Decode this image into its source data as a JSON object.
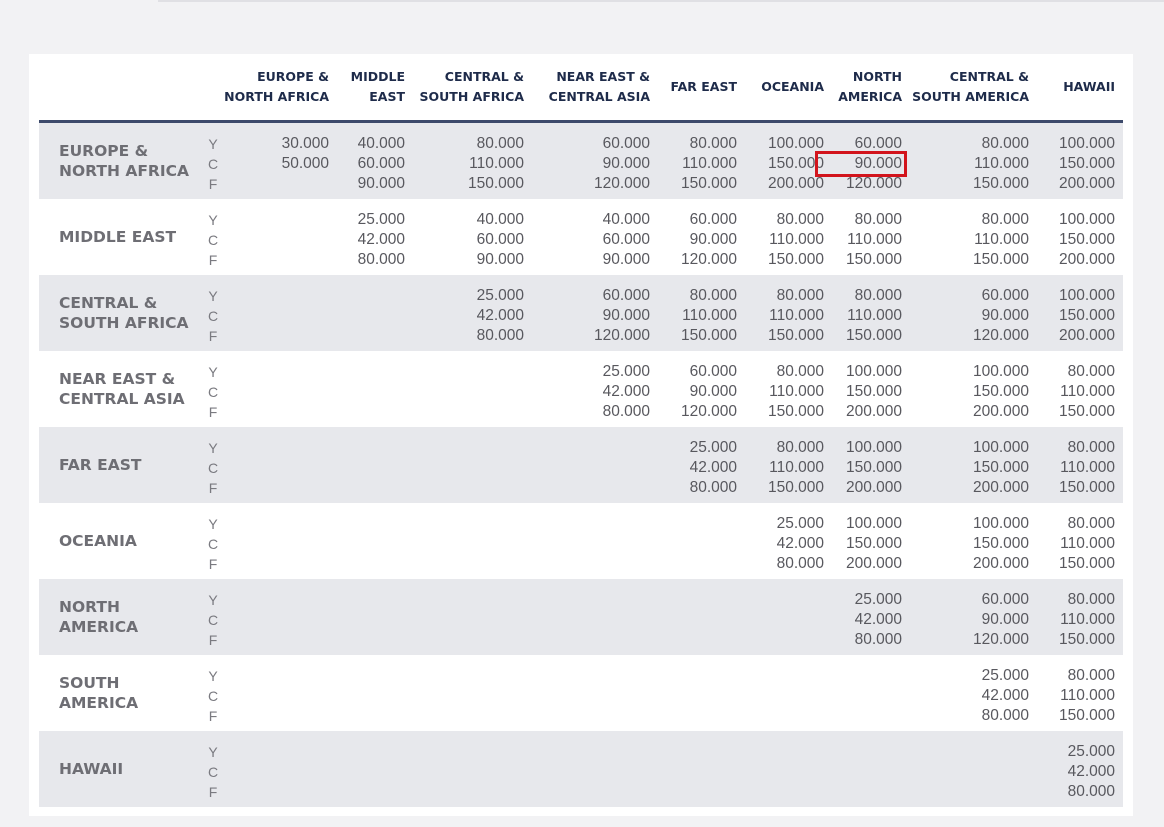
{
  "columns": [
    "EUROPE &\nNORTH AFRICA",
    "MIDDLE\nEAST",
    "CENTRAL &\nSOUTH AFRICA",
    "NEAR EAST &\nCENTRAL ASIA",
    "FAR EAST",
    "OCEANIA",
    "NORTH\nAMERICA",
    "CENTRAL &\nSOUTH AMERICA",
    "HAWAII"
  ],
  "classes": [
    "Y",
    "C",
    "F"
  ],
  "highlight": {
    "row": 0,
    "col": 6,
    "cls": 1,
    "color": "#d2141c"
  },
  "rows": [
    {
      "label": "EUROPE &\nNORTH AFRICA",
      "values": [
        [
          "30.000",
          "50.000",
          ""
        ],
        [
          "40.000",
          "60.000",
          "90.000"
        ],
        [
          "80.000",
          "110.000",
          "150.000"
        ],
        [
          "60.000",
          "90.000",
          "120.000"
        ],
        [
          "80.000",
          "110.000",
          "150.000"
        ],
        [
          "100.000",
          "150.000",
          "200.000"
        ],
        [
          "60.000",
          "90.000",
          "120.000"
        ],
        [
          "80.000",
          "110.000",
          "150.000"
        ],
        [
          "100.000",
          "150.000",
          "200.000"
        ]
      ]
    },
    {
      "label": "MIDDLE EAST",
      "values": [
        null,
        [
          "25.000",
          "42.000",
          "80.000"
        ],
        [
          "40.000",
          "60.000",
          "90.000"
        ],
        [
          "40.000",
          "60.000",
          "90.000"
        ],
        [
          "60.000",
          "90.000",
          "120.000"
        ],
        [
          "80.000",
          "110.000",
          "150.000"
        ],
        [
          "80.000",
          "110.000",
          "150.000"
        ],
        [
          "80.000",
          "110.000",
          "150.000"
        ],
        [
          "100.000",
          "150.000",
          "200.000"
        ]
      ]
    },
    {
      "label": "CENTRAL &\nSOUTH AFRICA",
      "values": [
        null,
        null,
        [
          "25.000",
          "42.000",
          "80.000"
        ],
        [
          "60.000",
          "90.000",
          "120.000"
        ],
        [
          "80.000",
          "110.000",
          "150.000"
        ],
        [
          "80.000",
          "110.000",
          "150.000"
        ],
        [
          "80.000",
          "110.000",
          "150.000"
        ],
        [
          "60.000",
          "90.000",
          "120.000"
        ],
        [
          "100.000",
          "150.000",
          "200.000"
        ]
      ]
    },
    {
      "label": "NEAR EAST &\nCENTRAL ASIA",
      "values": [
        null,
        null,
        null,
        [
          "25.000",
          "42.000",
          "80.000"
        ],
        [
          "60.000",
          "90.000",
          "120.000"
        ],
        [
          "80.000",
          "110.000",
          "150.000"
        ],
        [
          "100.000",
          "150.000",
          "200.000"
        ],
        [
          "100.000",
          "150.000",
          "200.000"
        ],
        [
          "80.000",
          "110.000",
          "150.000"
        ]
      ]
    },
    {
      "label": "FAR EAST",
      "values": [
        null,
        null,
        null,
        null,
        [
          "25.000",
          "42.000",
          "80.000"
        ],
        [
          "80.000",
          "110.000",
          "150.000"
        ],
        [
          "100.000",
          "150.000",
          "200.000"
        ],
        [
          "100.000",
          "150.000",
          "200.000"
        ],
        [
          "80.000",
          "110.000",
          "150.000"
        ]
      ]
    },
    {
      "label": "OCEANIA",
      "values": [
        null,
        null,
        null,
        null,
        null,
        [
          "25.000",
          "42.000",
          "80.000"
        ],
        [
          "100.000",
          "150.000",
          "200.000"
        ],
        [
          "100.000",
          "150.000",
          "200.000"
        ],
        [
          "80.000",
          "110.000",
          "150.000"
        ]
      ]
    },
    {
      "label": "NORTH\nAMERICA",
      "values": [
        null,
        null,
        null,
        null,
        null,
        null,
        [
          "25.000",
          "42.000",
          "80.000"
        ],
        [
          "60.000",
          "90.000",
          "120.000"
        ],
        [
          "80.000",
          "110.000",
          "150.000"
        ]
      ]
    },
    {
      "label": "SOUTH\nAMERICA",
      "values": [
        null,
        null,
        null,
        null,
        null,
        null,
        null,
        [
          "25.000",
          "42.000",
          "80.000"
        ],
        [
          "80.000",
          "110.000",
          "150.000"
        ]
      ]
    },
    {
      "label": "HAWAII",
      "values": [
        null,
        null,
        null,
        null,
        null,
        null,
        null,
        null,
        [
          "25.000",
          "42.000",
          "80.000"
        ]
      ]
    }
  ]
}
